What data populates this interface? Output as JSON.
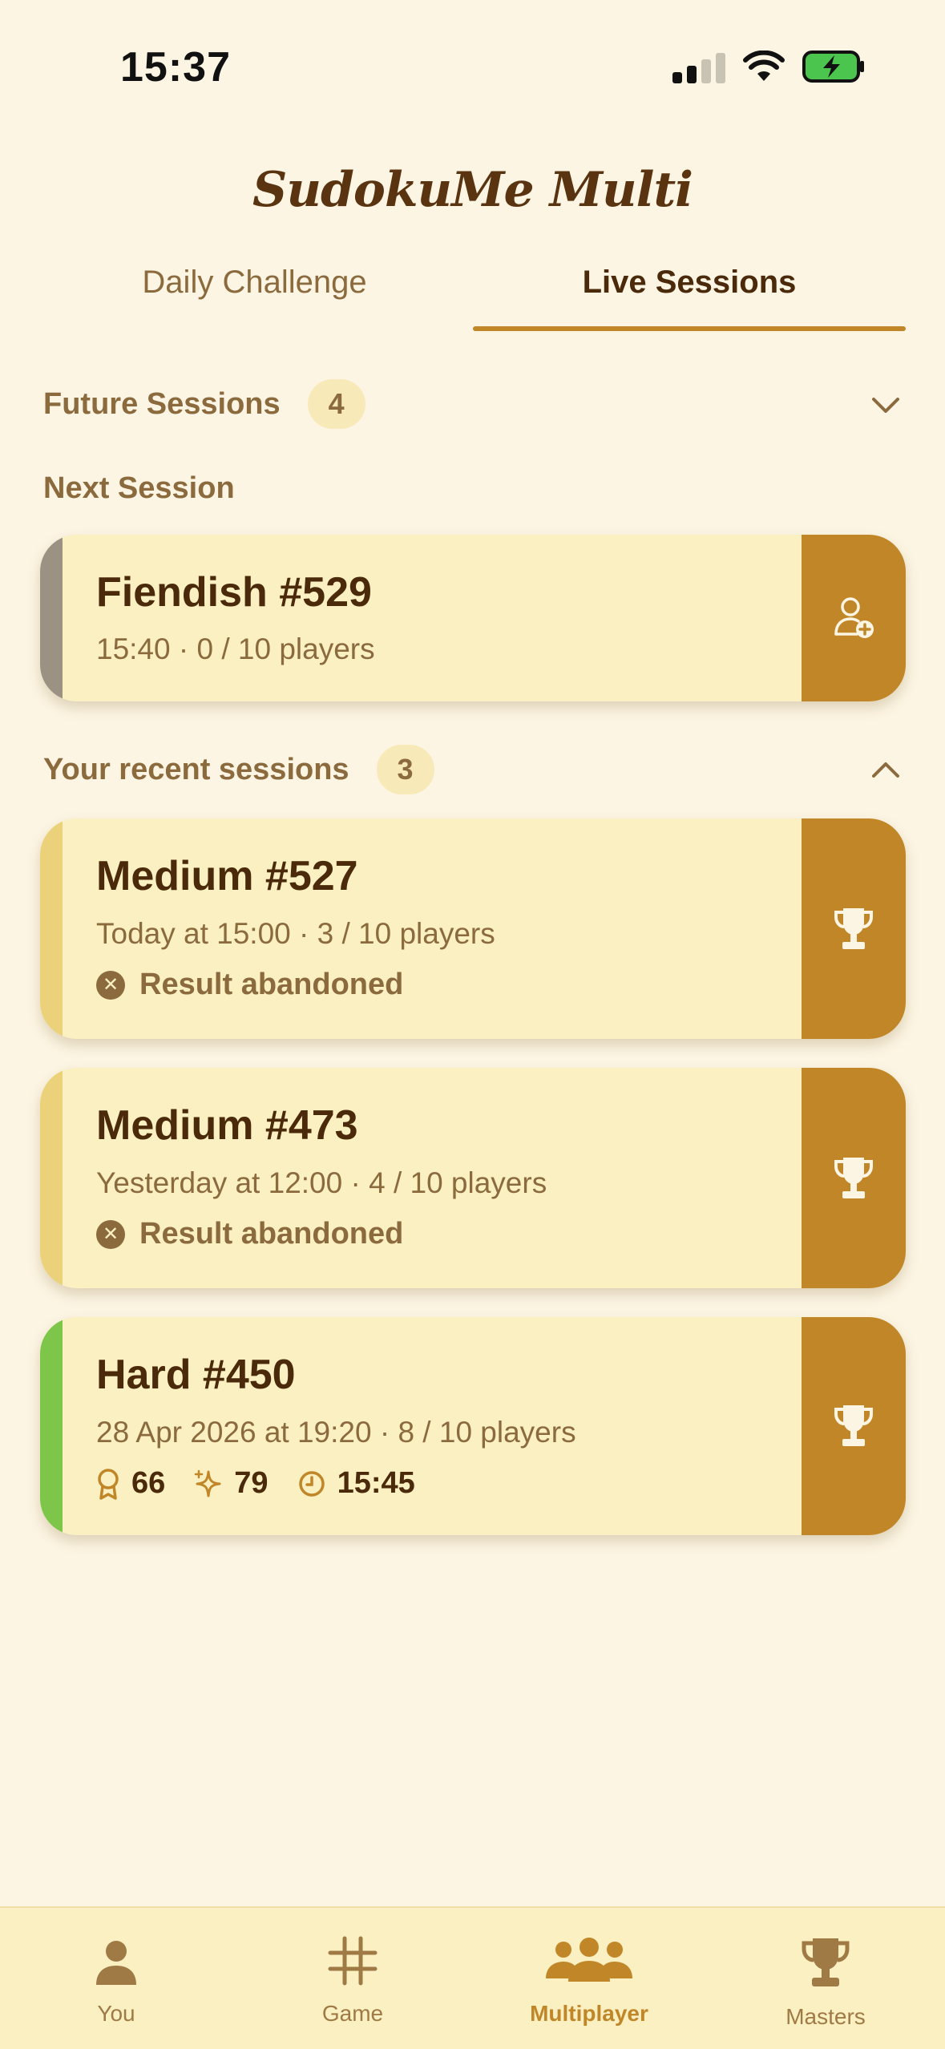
{
  "status_bar": {
    "time": "15:37"
  },
  "app": {
    "title": "SudokuMe Multi"
  },
  "tabs": [
    {
      "label": "Daily Challenge",
      "active": false
    },
    {
      "label": "Live Sessions",
      "active": true
    }
  ],
  "future_sessions": {
    "title": "Future Sessions",
    "count": "4"
  },
  "next_session": {
    "label": "Next Session",
    "card": {
      "title": "Fiendish #529",
      "subtitle": "15:40 · 0 / 10 players",
      "stripe_color": "#9C9283",
      "action_icon": "add-user-icon"
    }
  },
  "recent_sessions": {
    "title": "Your recent sessions",
    "count": "3",
    "items": [
      {
        "title": "Medium #527",
        "subtitle": "Today at 15:00 · 3 / 10 players",
        "status": "Result abandoned",
        "stripe_color": "#EBD27A"
      },
      {
        "title": "Medium #473",
        "subtitle": "Yesterday at 12:00 · 4 / 10 players",
        "status": "Result abandoned",
        "stripe_color": "#EBD27A"
      },
      {
        "title": "Hard #450",
        "subtitle": "28 Apr 2026 at 19:20 · 8 / 10 players",
        "stripe_color": "#7DC64A",
        "stats": {
          "rank": "66",
          "score": "79",
          "time": "15:45"
        }
      }
    ]
  },
  "bottom_nav": [
    {
      "label": "You",
      "icon": "person-icon",
      "active": false
    },
    {
      "label": "Game",
      "icon": "grid-hash-icon",
      "active": false
    },
    {
      "label": "Multiplayer",
      "icon": "group-icon",
      "active": true
    },
    {
      "label": "Masters",
      "icon": "trophy-icon",
      "active": false
    }
  ],
  "colors": {
    "background": "#FCF5E3",
    "card": "#FAF0C2",
    "accent": "#C08628",
    "text_dark": "#4A2A0A",
    "text_muted": "#8B6A3E"
  }
}
